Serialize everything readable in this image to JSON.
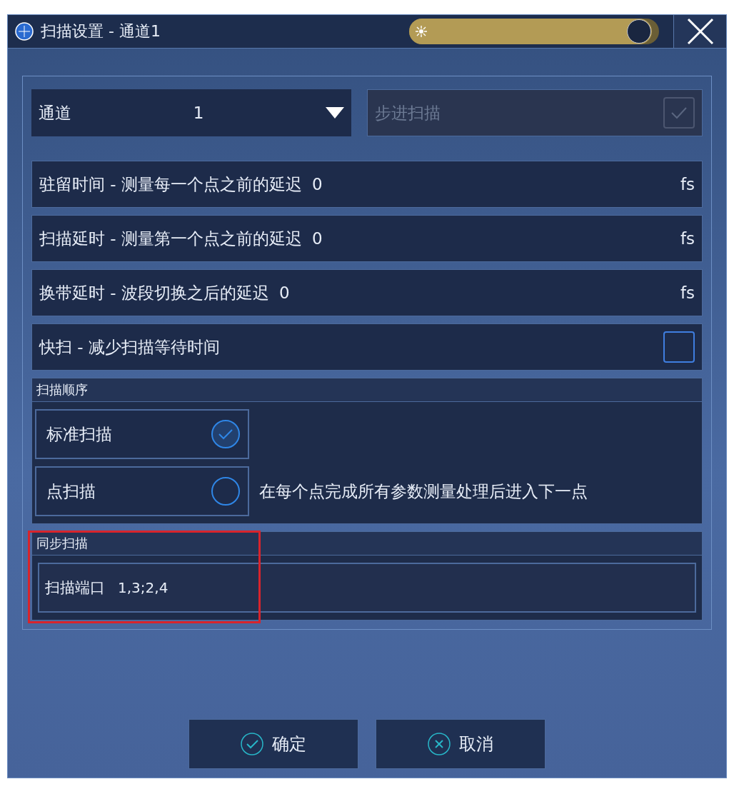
{
  "window": {
    "title": "扫描设置 - 通道1"
  },
  "brightness": {
    "level": 0.97
  },
  "channel": {
    "label": "通道",
    "value": "1"
  },
  "step_sweep": {
    "label": "步进扫描",
    "checked": true,
    "disabled": true
  },
  "delays": [
    {
      "label": "驻留时间 - 测量每一个点之前的延迟",
      "value": "0",
      "unit": "fs"
    },
    {
      "label": "扫描延时 - 测量第一个点之前的延迟",
      "value": "0",
      "unit": "fs"
    },
    {
      "label": "换带延时 - 波段切换之后的延迟",
      "value": "0",
      "unit": "fs"
    }
  ],
  "fast_sweep": {
    "label": "快扫 - 减少扫描等待时间",
    "checked": false
  },
  "sweep_order": {
    "title": "扫描顺序",
    "options": [
      {
        "label": "标准扫描",
        "selected": true
      },
      {
        "label": "点扫描",
        "selected": false,
        "description": "在每个点完成所有参数测量处理后进入下一点"
      }
    ]
  },
  "sync_sweep": {
    "title": "同步扫描",
    "highlighted": true,
    "field": {
      "label": "扫描端口",
      "value": "1,3;2,4"
    }
  },
  "buttons": [
    {
      "label": "确定",
      "kind": "ok"
    },
    {
      "label": "取消",
      "kind": "cancel"
    }
  ]
}
